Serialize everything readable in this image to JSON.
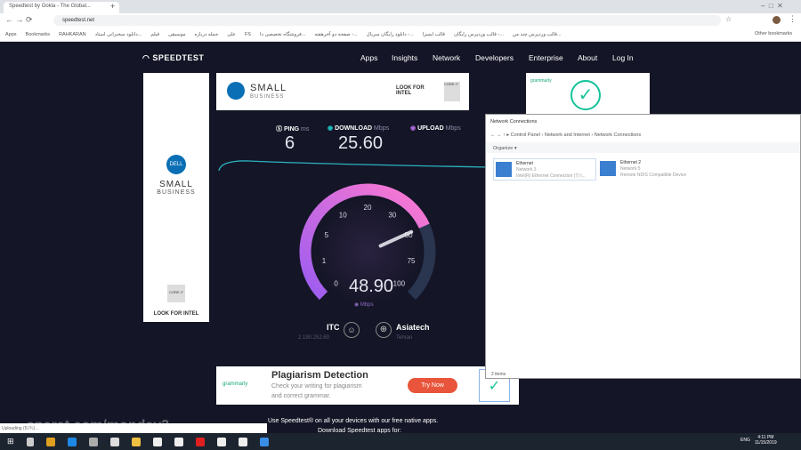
{
  "browser": {
    "tab_title": "Speedtest by Ookla - The Global...",
    "url": "speedtest.net",
    "bookmarks": [
      "Apps",
      "Bookmarks",
      "RAHKARAN",
      "دانلود سخنرانی استاد...",
      "فیلم",
      "موسیقی",
      "جمله درباره",
      "علی",
      "FS",
      "فروشگاه تخصصی دا...",
      "صفحه دو آخرهفته -...",
      "دانلود رایگان سریال -...",
      "قالب ایمیزا",
      "قالب وردپرس رایگان -...",
      "قالب وردپرس چند من..."
    ],
    "other_bookmarks": "Other bookmarks"
  },
  "speedtest": {
    "logo": "SPEEDTEST",
    "nav": [
      "Apps",
      "Insights",
      "Network",
      "Developers",
      "Enterprise",
      "About",
      "Log In"
    ],
    "ping": {
      "label": "PING",
      "unit": "ms",
      "value": "6"
    },
    "download": {
      "label": "DOWNLOAD",
      "unit": "Mbps",
      "value": "25.60"
    },
    "upload": {
      "label": "UPLOAD",
      "unit": "Mbps"
    },
    "gauge": {
      "ticks": [
        0,
        1,
        5,
        10,
        20,
        30,
        50,
        75,
        100
      ],
      "value": 48.9,
      "display": "48.90",
      "unit": "Mbps"
    },
    "isp": {
      "name": "ITC",
      "ip": "2.190.252.60"
    },
    "server": {
      "name": "Asiatech",
      "city": "Tehran"
    },
    "apps_text": "Use Speedtest® on all your devices with our free native apps.",
    "download_apps": "Download Speedtest apps for:",
    "status": "Uploading (51%)..."
  },
  "ads": {
    "dell_brand": "DELL",
    "dell_small": "SMALL",
    "dell_business": "BUSINESS",
    "intel": "LOOK FOR INTEL",
    "core": "CORE i7",
    "grammarly": "grammarly",
    "plag_title": "Plagiarism Detection",
    "plag_text1": "Check your writing for plagiarism",
    "plag_text2": "and correct grammar.",
    "try_now": "Try Now"
  },
  "explorer": {
    "title": "Network Connections",
    "path": [
      "Control Panel",
      "Network and Internet",
      "Network Connections"
    ],
    "organize": "Organize ▾",
    "items": [
      {
        "name": "Ethernet",
        "network": "Network 3",
        "device": "Intel(R) Ethernet Connection (7) I..."
      },
      {
        "name": "Ethernet 2",
        "network": "Network 5",
        "device": "Remote NDIS Compatible Device"
      }
    ],
    "status": "2 items"
  },
  "taskbar": {
    "lang": "ENG",
    "time": "4:11 PM",
    "date": "11/15/2019"
  },
  "watermark": "aparat.com/monday2",
  "colors": {
    "bg": "#141526",
    "accent": "#e05cc6",
    "download": "#1ec8c8"
  }
}
